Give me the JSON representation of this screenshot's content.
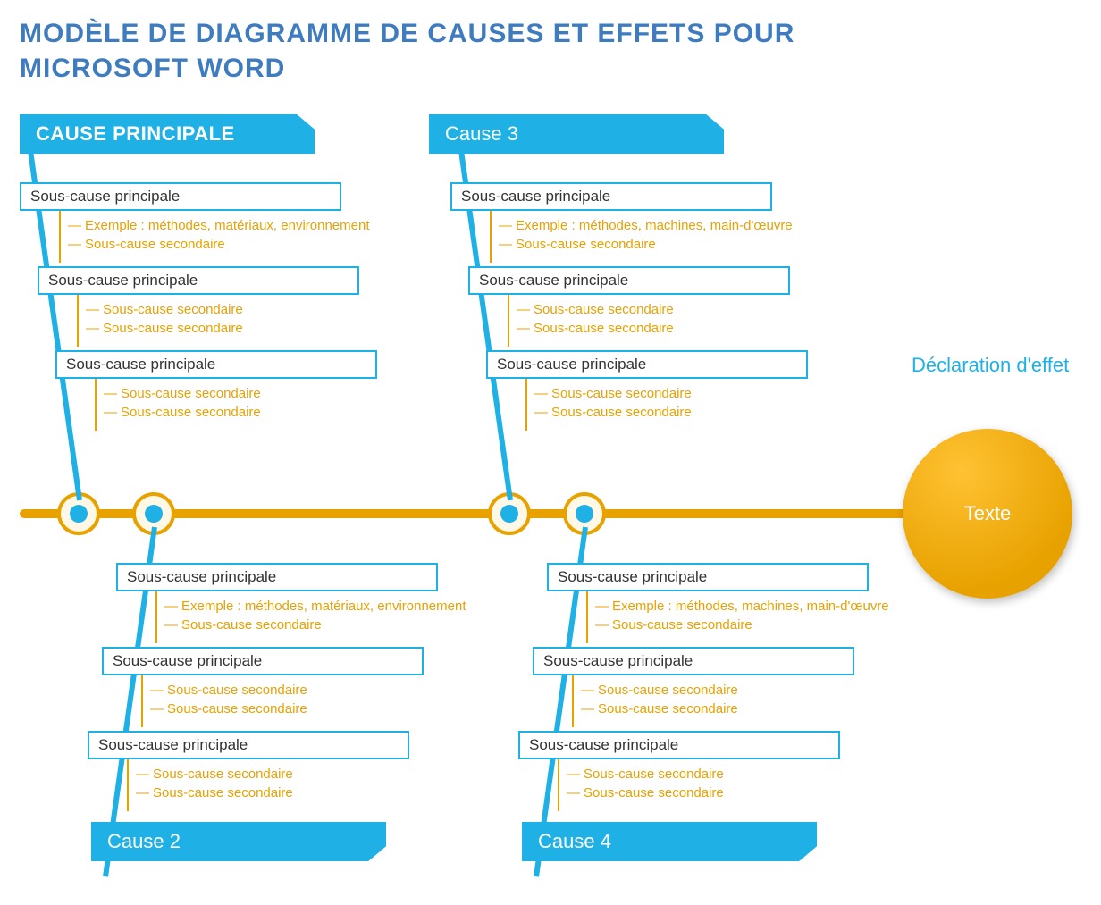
{
  "title_line1": "MODÈLE DE DIAGRAMME DE CAUSES ET EFFETS POUR",
  "title_line2": "MICROSOFT WORD",
  "effect_label": "Déclaration d'effet",
  "effect_text": "Texte",
  "colors": {
    "blue": "#1fb0e6",
    "title_blue": "#3f7cbf",
    "orange": "#e8a200"
  },
  "causes": {
    "c1": {
      "label": "CAUSE PRINCIPALE",
      "subs": [
        {
          "main": "Sous-cause principale",
          "secs": [
            "Exemple : méthodes, matériaux, environnement",
            "Sous-cause secondaire"
          ]
        },
        {
          "main": "Sous-cause principale",
          "secs": [
            "Sous-cause secondaire",
            "Sous-cause secondaire"
          ]
        },
        {
          "main": "Sous-cause principale",
          "secs": [
            "Sous-cause secondaire",
            "Sous-cause secondaire"
          ]
        }
      ]
    },
    "c2": {
      "label": "Cause 2",
      "subs": [
        {
          "main": "Sous-cause principale",
          "secs": [
            "Exemple : méthodes, matériaux, environnement",
            "Sous-cause secondaire"
          ]
        },
        {
          "main": "Sous-cause principale",
          "secs": [
            "Sous-cause secondaire",
            "Sous-cause secondaire"
          ]
        },
        {
          "main": "Sous-cause principale",
          "secs": [
            "Sous-cause secondaire",
            "Sous-cause secondaire"
          ]
        }
      ]
    },
    "c3": {
      "label": "Cause 3",
      "subs": [
        {
          "main": "Sous-cause principale",
          "secs": [
            "Exemple : méthodes, machines, main-d'œuvre",
            "Sous-cause secondaire"
          ]
        },
        {
          "main": "Sous-cause principale",
          "secs": [
            "Sous-cause secondaire",
            "Sous-cause secondaire"
          ]
        },
        {
          "main": "Sous-cause principale",
          "secs": [
            "Sous-cause secondaire",
            "Sous-cause secondaire"
          ]
        }
      ]
    },
    "c4": {
      "label": "Cause 4",
      "subs": [
        {
          "main": "Sous-cause principale",
          "secs": [
            "Exemple : méthodes, machines, main-d'œuvre",
            "Sous-cause secondaire"
          ]
        },
        {
          "main": "Sous-cause principale",
          "secs": [
            "Sous-cause secondaire",
            "Sous-cause secondaire"
          ]
        },
        {
          "main": "Sous-cause principale",
          "secs": [
            "Sous-cause secondaire",
            "Sous-cause secondaire"
          ]
        }
      ]
    }
  }
}
